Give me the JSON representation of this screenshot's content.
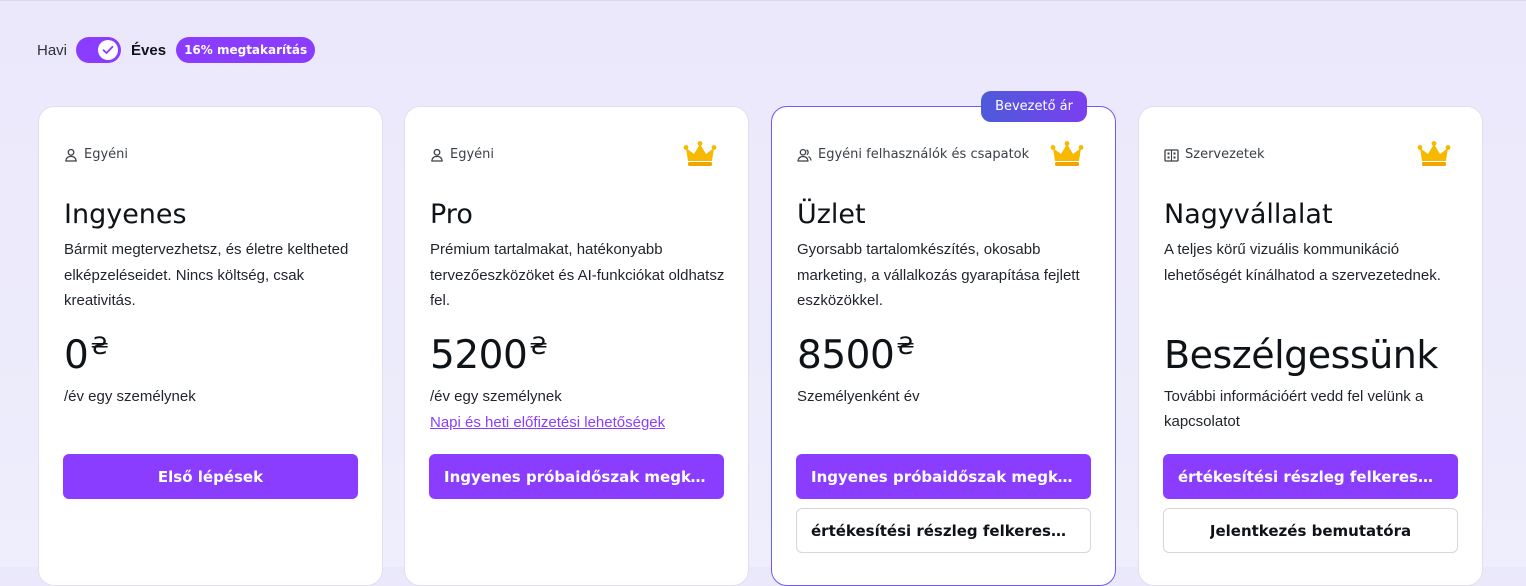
{
  "billing": {
    "monthly_label": "Havi",
    "yearly_label": "Éves",
    "savings_badge": "16% megtakarítás",
    "toggle_state": "yearly"
  },
  "plans": [
    {
      "audience": "Egyéni",
      "audience_icon": "person-icon",
      "crown": false,
      "name": "Ingyenes",
      "description": "Bármit megtervezhetsz, és életre keltheted elképzeléseidet. Nincs költség, csak kreativitás.",
      "price": "0",
      "currency": "₴",
      "per": "/év egy személynek",
      "primary_button": "Első lépések"
    },
    {
      "audience": "Egyéni",
      "audience_icon": "person-icon",
      "crown": true,
      "name": "Pro",
      "description": "Prémium tartalmakat, hatékonyabb tervezőeszközöket és AI-funkciókat oldhatsz fel.",
      "price": "5200",
      "currency": "₴",
      "per": "/év egy személynek",
      "link": "Napi és heti előfizetési lehetőségek",
      "primary_button": "Ingyenes próbaidőszak megkezdése"
    },
    {
      "badge": "Bevezető ár",
      "audience": "Egyéni felhasználók és csapatok",
      "audience_icon": "people-icon",
      "crown": true,
      "name": "Üzlet",
      "description": "Gyorsabb tartalomkészítés, okosabb marketing, a vállalkozás gyarapítása fejlett eszközökkel.",
      "price": "8500",
      "currency": "₴",
      "per": "Személyenként év",
      "primary_button": "Ingyenes próbaidőszak megkezdése",
      "secondary_button": "értékesítési részleg felkeresése"
    },
    {
      "audience": "Szervezetek",
      "audience_icon": "building-icon",
      "crown": true,
      "name": "Nagyvállalat",
      "description": "A teljes körű vizuális kommunikáció lehetőségét kínálhatod a szervezetednek.",
      "price": "Beszélgessünk",
      "per": "További információért vedd fel velünk a kapcsolatot",
      "primary_button": "értékesítési részleg felkeresése",
      "secondary_button": "Jelentkezés bemutatóra"
    }
  ],
  "colors": {
    "accent": "#8b3dff",
    "badge_gradient_start": "#4c5bd9",
    "badge_gradient_end": "#7b3ff0",
    "crown": "#f5b400"
  }
}
